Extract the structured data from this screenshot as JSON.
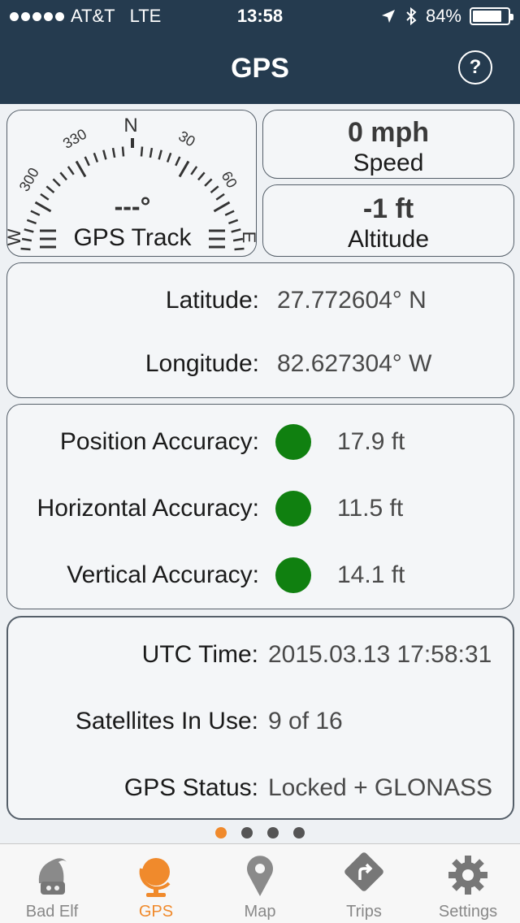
{
  "status_bar": {
    "carrier": "AT&T",
    "network": "LTE",
    "time": "13:58",
    "battery": "84%",
    "battery_level": 0.84
  },
  "nav": {
    "title": "GPS",
    "help_label": "?"
  },
  "compass": {
    "marks": [
      "N",
      "30",
      "60",
      "E",
      "300",
      "330",
      "W"
    ],
    "heading": "---°",
    "label": "GPS Track"
  },
  "speed": {
    "value": "0 mph",
    "label": "Speed"
  },
  "altitude": {
    "value": "-1 ft",
    "label": "Altitude"
  },
  "coordinates": {
    "latitude_label": "Latitude:",
    "latitude_value": "27.772604° N",
    "longitude_label": "Longitude:",
    "longitude_value": "82.627304° W"
  },
  "accuracy": {
    "status_color": "#108010",
    "rows": [
      {
        "label": "Position Accuracy:",
        "value": "17.9 ft"
      },
      {
        "label": "Horizontal Accuracy:",
        "value": "11.5 ft"
      },
      {
        "label": "Vertical Accuracy:",
        "value": "14.1 ft"
      }
    ]
  },
  "info": {
    "rows": [
      {
        "label": "UTC Time:",
        "value": "2015.03.13 17:58:31"
      },
      {
        "label": "Satellites In Use:",
        "value": "9 of 16"
      },
      {
        "label": "GPS Status:",
        "value": "Locked + GLONASS"
      }
    ]
  },
  "pager": {
    "count": 4,
    "active_index": 0
  },
  "tabs": [
    {
      "label": "Bad Elf",
      "icon": "elf-icon",
      "active": false
    },
    {
      "label": "GPS",
      "icon": "globe-icon",
      "active": true
    },
    {
      "label": "Map",
      "icon": "map-pin-icon",
      "active": false
    },
    {
      "label": "Trips",
      "icon": "trips-icon",
      "active": false
    },
    {
      "label": "Settings",
      "icon": "gear-icon",
      "active": false
    }
  ],
  "colors": {
    "header_bg": "#253b4f",
    "accent": "#f08a2c",
    "status_green": "#108010"
  }
}
